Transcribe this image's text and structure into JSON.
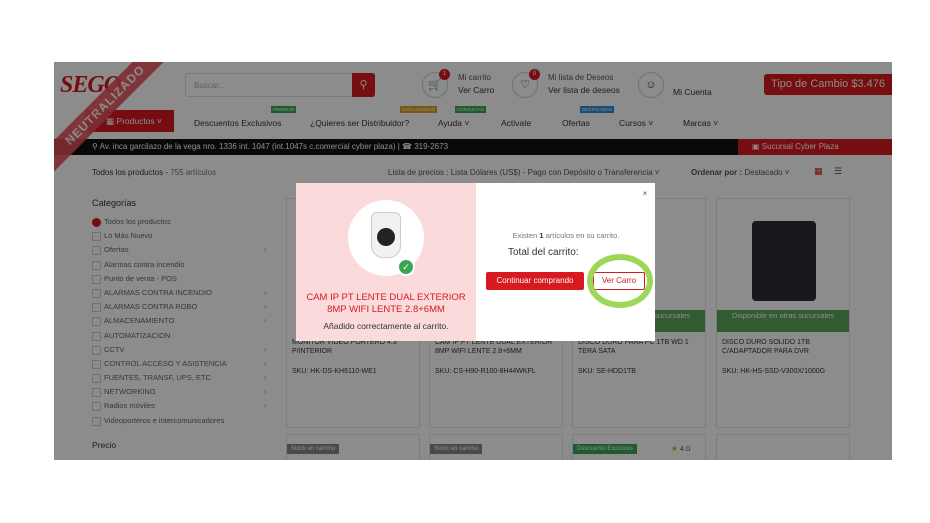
{
  "header": {
    "logo": "SEGO",
    "search_placeholder": "Buscar...",
    "cart_count": "1",
    "cart_title": "Mi carrito",
    "cart_link": "Ver Carro",
    "wishlist_count": "0",
    "wishlist_title": "Mi lista de Deseos",
    "wishlist_link": "Ver lista de deseos",
    "account": "Mi Cuenta",
    "exchange": "Tipo de Cambio $3.476"
  },
  "ribbon": "NEUTRALIZADO",
  "nav": {
    "productos": "Productos",
    "items": [
      "Descuentos Exclusivos",
      "¿Quieres ser Distribuidor?",
      "Ayuda",
      "Activate",
      "Ofertas",
      "Cursos",
      "Marcas"
    ],
    "tags": [
      "PREMIUM",
      "EXCLUSIVIDAD",
      "CONSULTAS",
      "DESTACADAS"
    ]
  },
  "address": "Av. inca garcilazo de la vega nro. 1336 int. 1047 (int.1047s c.comercial cyber plaza) | ☎ 319-2673",
  "sucursal": "Sucursal Cyber Plaza",
  "listing": {
    "all_products": "Todos los productos",
    "count": "755 artículos",
    "price_list_label": "Lista de precios :",
    "price_list_value": "Lista Dólares (US$) - Pago con Depósito o Transferencia",
    "order_label": "Ordenar por :",
    "order_value": "Destacado"
  },
  "sidebar": {
    "title": "Categorías",
    "items": [
      "Todos los productos",
      "Lo Más Nuevo",
      "Ofertas",
      "Alarmas contra incendio",
      "Punto de venta - POS",
      "ALARMAS CONTRA INCENDIO",
      "ALARMAS CONTRA ROBO",
      "ALMACENAMIENTO",
      "AUTOMATIZACION",
      "CCTV",
      "CONTROL ACCESO Y ASISTENCIA",
      "FUENTES, TRANSF, UPS, ETC",
      "NETWORKING",
      "Radios móviles",
      "Videoporteros e intercomunicadores"
    ],
    "price_title": "Precio"
  },
  "products": [
    {
      "name": "MONITOR VIDEO PORTERO 4.3\" P/INTERIOR",
      "sku": "SKU: HK-DS-KH6110-WE1"
    },
    {
      "name": "CAM IP PT LENTE DUAL EXTERIOR 8MP WIFI LENTE 2.8+6MM",
      "sku": "SKU: CS-H90-R100-8H44WKFL"
    },
    {
      "name": "DISCO DURO PARA PC 1TB WD 1 TERA SATA",
      "sku": "SKU: SE-HDD1TB"
    },
    {
      "name": "DISCO DURO SOLIDO 1TB C/ADAPTADOR PARA DVR",
      "sku": "SKU: HK-HS-SSD-V300X/1000G"
    }
  ],
  "other_branches": "Disponible en otras sucursales",
  "stock_tag": "Stock en camino",
  "discount_tag": "Descuento Exclusivo",
  "rating": "4.0",
  "modal": {
    "product_name": "CAM IP PT LENTE DUAL EXTERIOR 8MP WIFI LENTE 2.8+6MM",
    "added": "Añadido correctamente al carrito.",
    "exists_prefix": "Existen",
    "exists_count": "1",
    "exists_suffix": "artículos en su carrito.",
    "total": "Total del carrito:",
    "continue": "Continuar comprando",
    "view_cart": "Ver Carro",
    "close": "×"
  },
  "colors": {
    "brand_red": "#d71920",
    "success_green": "#3aa655",
    "highlight": "#9ed65a"
  }
}
